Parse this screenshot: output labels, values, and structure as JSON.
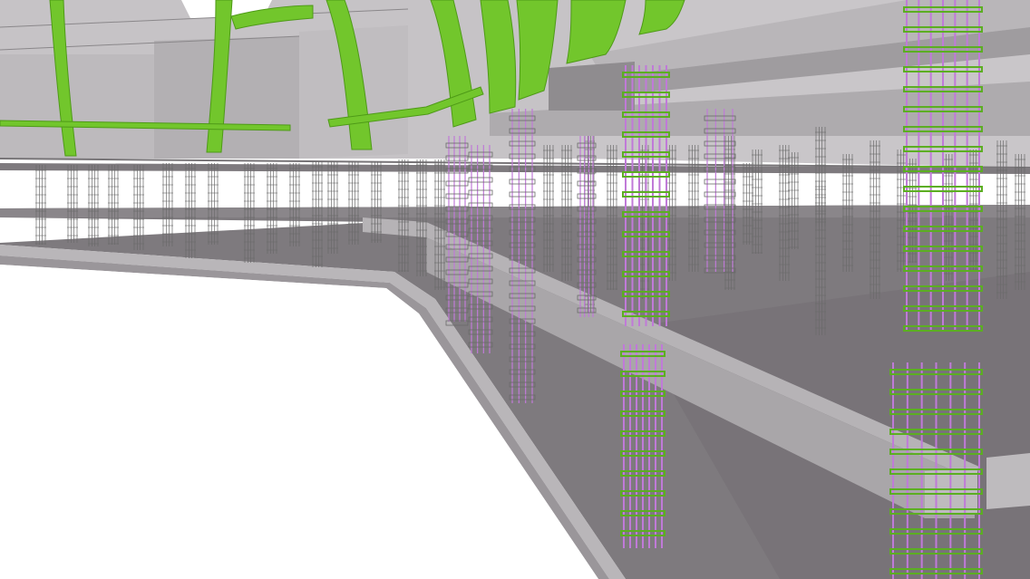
{
  "viewport": {
    "kind": "3d-bim-model-view",
    "background_color": "#ffffff"
  },
  "colors": {
    "slab_top": "#7e7a7e",
    "slab_dark": "#6b676b",
    "slab_edge": "#b9b6b9",
    "slab_edge_shadow": "#9a969a",
    "ceiling": "#c9c6c9",
    "ceiling_dark": "#a8a5a8",
    "wall": "#bfbcbf",
    "curved_beam_green": "#72c62c",
    "curved_beam_green_dark": "#4e9a17",
    "rebar_purple": "#c07ad8",
    "stirrup_green": "#5cae22",
    "rebar_gray": "#6a6a6a",
    "beam_gray": "#a9a6a9"
  },
  "icons": {
    "model": "3d-structural-model"
  }
}
